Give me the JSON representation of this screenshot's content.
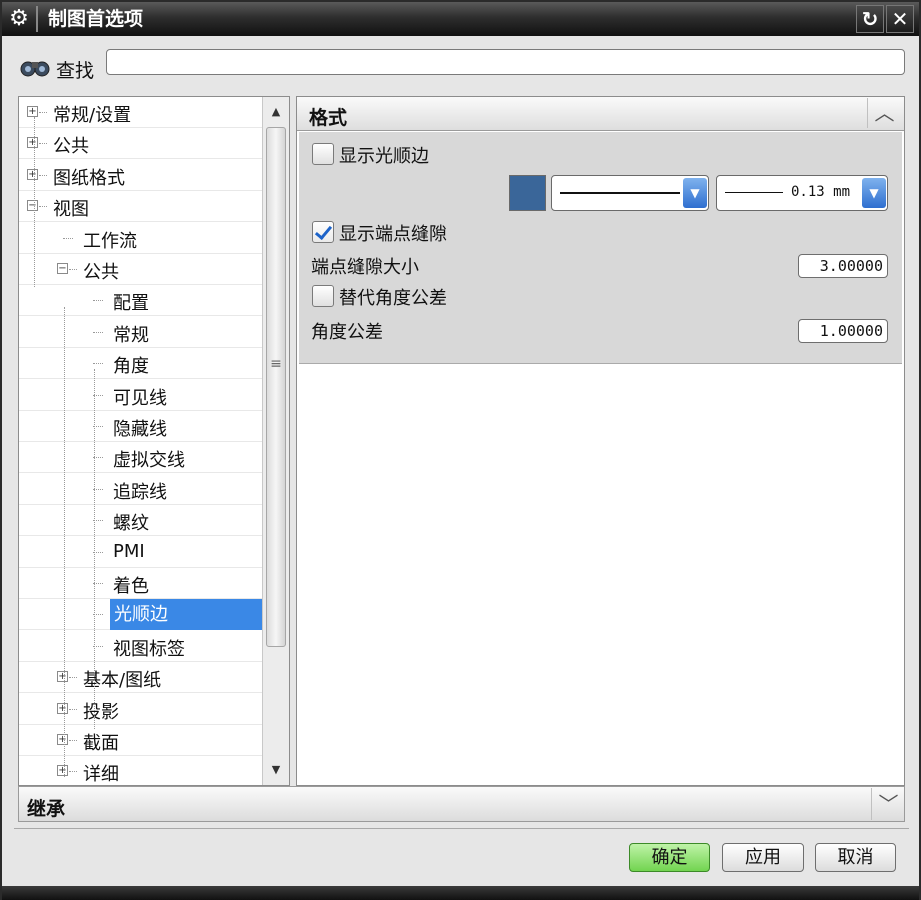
{
  "window": {
    "title": "制图首选项",
    "reset_icon": "reset-icon",
    "close_icon": "close-icon"
  },
  "search": {
    "label": "查找",
    "value": "",
    "icon": "binoculars-icon"
  },
  "tree": {
    "items": [
      {
        "label": "常规/设置",
        "expander": "+"
      },
      {
        "label": "公共",
        "expander": "+"
      },
      {
        "label": "图纸格式",
        "expander": "+"
      },
      {
        "label": "视图",
        "expander": "−"
      },
      {
        "label": "工作流"
      },
      {
        "label": "公共",
        "expander": "−"
      },
      {
        "label": "配置"
      },
      {
        "label": "常规"
      },
      {
        "label": "角度"
      },
      {
        "label": "可见线"
      },
      {
        "label": "隐藏线"
      },
      {
        "label": "虚拟交线"
      },
      {
        "label": "追踪线"
      },
      {
        "label": "螺纹"
      },
      {
        "label": "PMI"
      },
      {
        "label": "着色"
      },
      {
        "label": "光顺边",
        "selected": true
      },
      {
        "label": "视图标签"
      },
      {
        "label": "基本/图纸",
        "expander": "+"
      },
      {
        "label": "投影",
        "expander": "+"
      },
      {
        "label": "截面",
        "expander": "+"
      },
      {
        "label": "详细",
        "expander": "+"
      }
    ]
  },
  "format": {
    "title": "格式",
    "show_smooth_edges": {
      "label": "显示光顺边",
      "checked": false
    },
    "line_color": "#3a6699",
    "line_width_text": "0.13 mm",
    "show_endpoint_gap": {
      "label": "显示端点缝隙",
      "checked": true
    },
    "endpoint_gap_size": {
      "label": "端点缝隙大小",
      "value": "3.00000"
    },
    "override_angle_tolerance": {
      "label": "替代角度公差",
      "checked": false
    },
    "angle_tolerance": {
      "label": "角度公差",
      "value": "1.00000"
    }
  },
  "inherit": {
    "title": "继承"
  },
  "buttons": {
    "ok": "确定",
    "apply": "应用",
    "cancel": "取消"
  },
  "colors": {
    "selection": "#3a88e6",
    "ok_green": "#72d450"
  }
}
